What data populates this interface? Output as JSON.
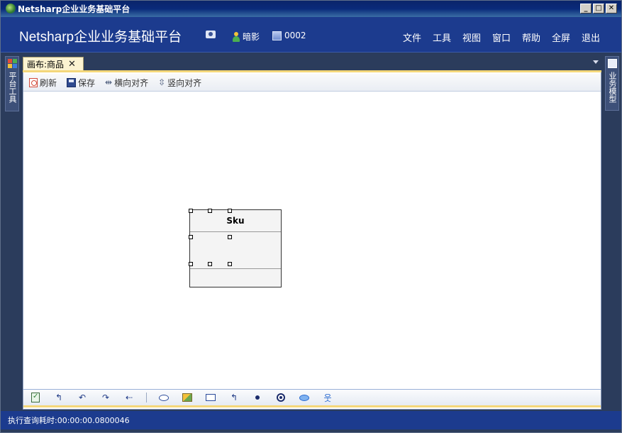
{
  "window": {
    "title": "Netsharp企业业务基础平台",
    "controls": {
      "minimize": "_",
      "maximize": "□",
      "close": "✕"
    }
  },
  "header": {
    "brand": "Netsharp企业业务基础平台",
    "user": "暗影",
    "workstation": "0002",
    "menu": [
      "文件",
      "工具",
      "视图",
      "窗口",
      "帮助",
      "全屏",
      "退出"
    ]
  },
  "side": {
    "left_label": "平台工具",
    "right_label": "业务模型"
  },
  "tab": {
    "label": "画布:商品",
    "close": "✕"
  },
  "toolbar": {
    "refresh_label": "刷新",
    "save_label": "保存",
    "align_h_label": "横向对齐",
    "align_v_label": "竖向对齐"
  },
  "canvas": {
    "entity_title": "Sku"
  },
  "toolbox": {
    "tools": [
      "select-icon",
      "assoc-arrow-icon",
      "curve-arrow-left-icon",
      "curve-arrow-right-icon",
      "dependency-arrow-icon",
      "usecase-oval-icon",
      "package-icon",
      "class-rect-icon",
      "assoc-arrow-alt-icon",
      "initial-node-icon",
      "final-node-icon",
      "state-oval-icon",
      "actor-icon"
    ]
  },
  "status": {
    "text": "执行查询耗时:00:00:00.0800046"
  },
  "colors": {
    "header_bg": "#1c3b8e",
    "frame_bg": "#2b3c5c",
    "tab_bg": "#fcf3d1",
    "accent_gold": "#f4d77a"
  }
}
